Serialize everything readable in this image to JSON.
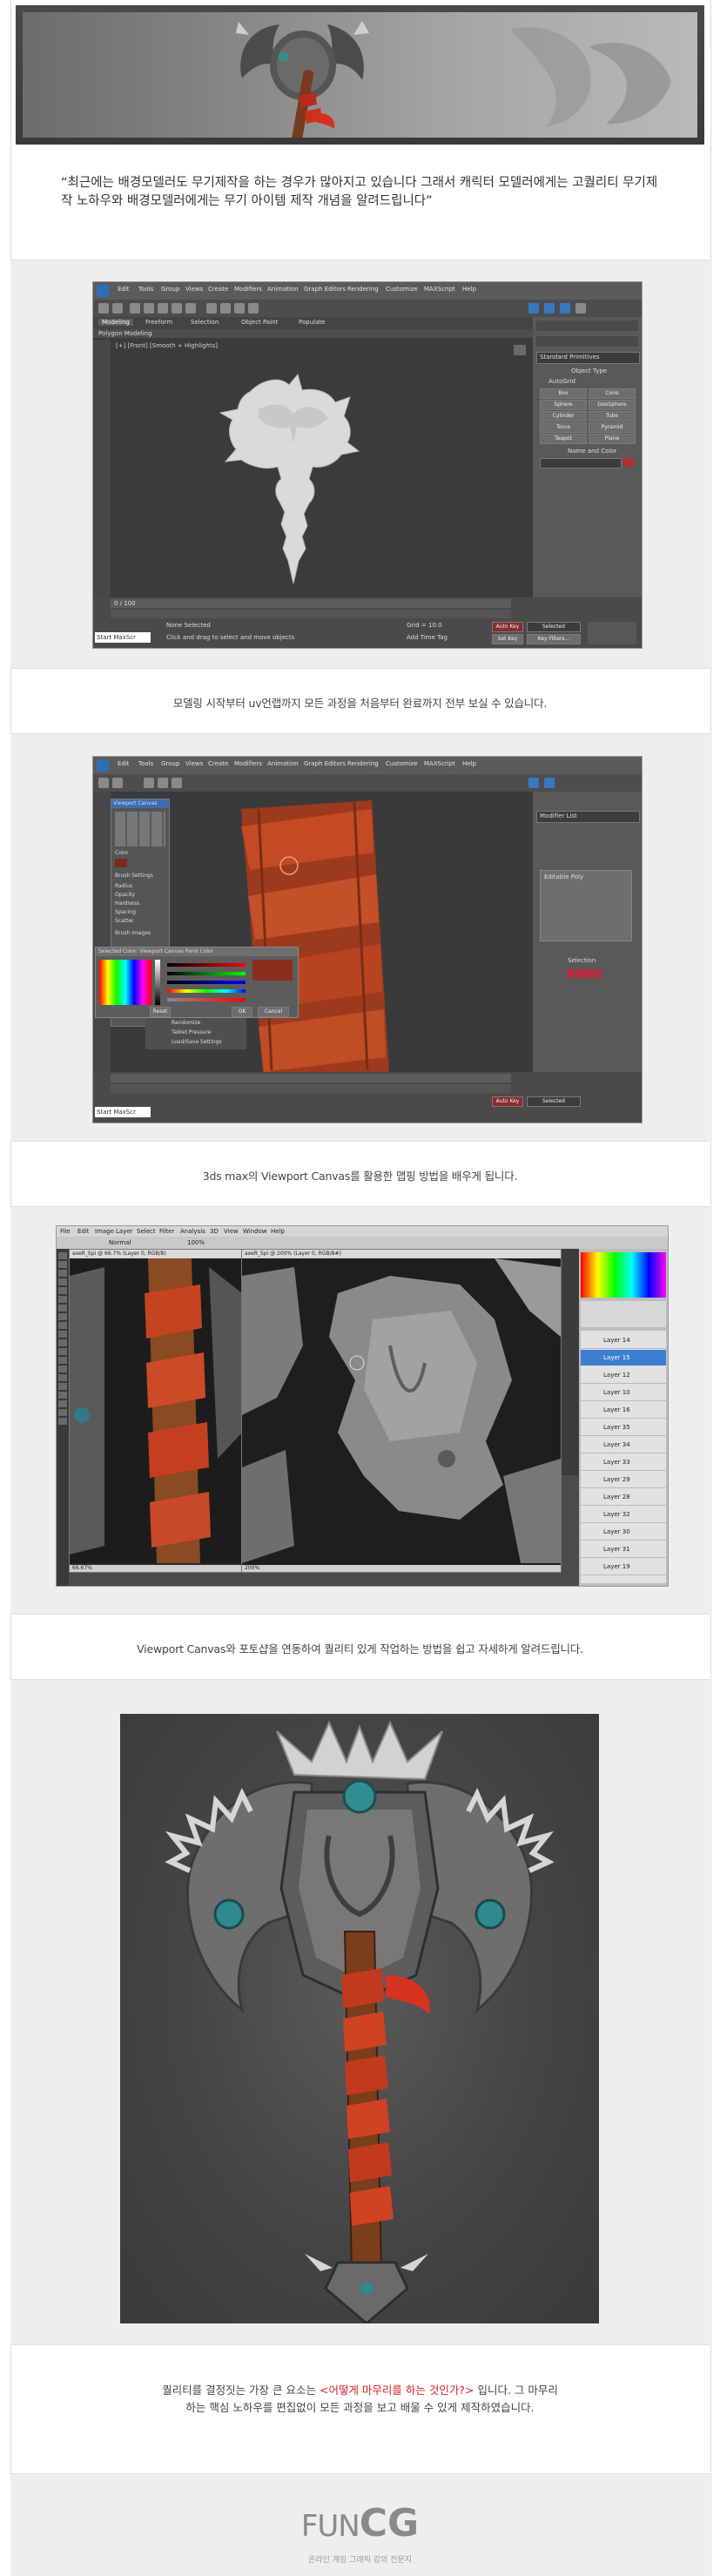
{
  "header": {
    "quote": "“최근에는 배경모델러도 무기제작을 하는 경우가 많아지고 있습니다 그래서 캐릭터 모델러에게는 고퀄리티 무기제작 노하우와 배경모델러에게는 무기 아이템 제작 개념을 알려드립니다”"
  },
  "sections": [
    {
      "caption": "모델링 시작부터 uv언랩까지 모든 과정을 처음부터 완료까지 전부 보실 수 있습니다."
    },
    {
      "caption": "3ds max의 Viewport Canvas를 활용한 맵핑 방법을 배우게 됩니다."
    },
    {
      "caption": "Viewport Canvas와 포토샵을 연동하여 퀄리티 있게 작업하는 방법을 쉽고 자세하게 알려드립니다."
    }
  ],
  "conclusion": {
    "line1_before": "퀄리티를 결정짓는 가장 큰 요소는 ",
    "line1_highlight": "<어떻게 마무리를 하는 것인가?>",
    "line1_after": " 입니다. 그 마무리",
    "line2": "하는 핵심 노하우를 편집없이 모든 과정을 보고 배울 수 있게 제작하였습니다."
  },
  "max_ui": {
    "menu": [
      "Edit",
      "Tools",
      "Group",
      "Views",
      "Create",
      "Modifiers",
      "Animation",
      "Graph Editors",
      "Rendering",
      "Customize",
      "MAXScript",
      "Help"
    ],
    "ribbon_tabs": [
      "Modeling",
      "Freeform",
      "Selection",
      "Object Paint",
      "Populate"
    ],
    "ribbon_label": "Polygon Modeling",
    "viewport_label": "[+] [Front] [Smooth + Highlights]",
    "panel_title": "Standard Primitives",
    "object_type_header": "Object Type",
    "autogrid": "AutoGrid",
    "primitives": [
      "Box",
      "Cone",
      "Sphere",
      "GeoSphere",
      "Cylinder",
      "Tube",
      "Torus",
      "Pyramid",
      "Teapot",
      "Plane"
    ],
    "name_color_header": "Name and Color",
    "status_none": "None Selected",
    "status_hint": "Click and drag to select and move objects",
    "add_time_tag": "Add Time Tag",
    "auto_key": "Auto Key",
    "set_key": "Set Key",
    "key_filters": "Key Filters...",
    "selected": "Selected",
    "welcome": "Start MaxScr",
    "timeline": "0 / 100",
    "grid": "Grid = 10.0"
  },
  "canvas_ui": {
    "title": "Viewport Canvas",
    "brush_settings": "Brush Settings",
    "brush_rows": [
      "Radius",
      "Opacity",
      "Hardness",
      "Spacing",
      "Scatter"
    ],
    "color_label": "Color",
    "select_color": "Selected Color: Viewport Canvas Paint Color",
    "ok": "OK",
    "cancel": "Cancel",
    "reset": "Reset",
    "editable_poly": "Editable Poly",
    "modifier_list": "Modifier List",
    "selection": "Selection",
    "menu": [
      "Edit",
      "Tools",
      "Group",
      "Views",
      "Create",
      "Modifiers",
      "Animation",
      "Graph Editors",
      "Rendering",
      "Customize",
      "MAXScript",
      "Help"
    ],
    "brush_images": "Brush Images",
    "bottom_rows": [
      "Randomize",
      "Tablet Pressure",
      "Load/Save Settings"
    ]
  },
  "ps_ui": {
    "menu": [
      "File",
      "Edit",
      "Image",
      "Layer",
      "Select",
      "Filter",
      "Analysis",
      "3D",
      "View",
      "Window",
      "Help"
    ],
    "mode": "Normal",
    "opacity": "100%",
    "tab1": "axeR_Spi @ 66.7% (Layer 0, RGB/8)",
    "tab2": "axeR_Spi @ 200% (Layer 0, RGB/8#)",
    "zoom1": "66.67%",
    "zoom2": "200%",
    "layers": [
      "Layer 14",
      "Layer 15",
      "Layer 12",
      "Layer 10",
      "Layer 16",
      "Layer 35",
      "Layer 34",
      "Layer 33",
      "Layer 29",
      "Layer 28",
      "Layer 32",
      "Layer 30",
      "Layer 31",
      "Layer 19"
    ]
  },
  "footer": {
    "logo_fun": "FUN",
    "logo_cg": "CG",
    "tagline": "온라인 게임 그래픽 강의 전문지"
  },
  "colors": {
    "highlight": "#d5202a",
    "accent_orange": "#c4441c",
    "logo_gray": "#8a8a8a",
    "ps_selected_layer": "#3c7ecf"
  }
}
